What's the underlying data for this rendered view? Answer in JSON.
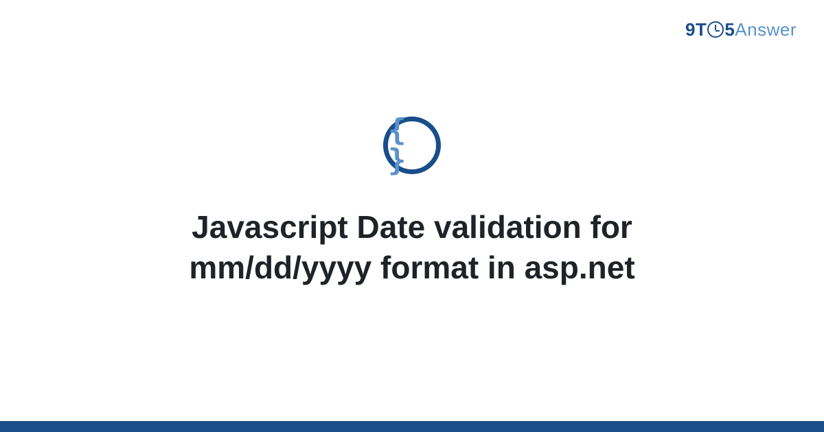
{
  "logo": {
    "part1": "9T",
    "part2": "5",
    "part3": "Answer"
  },
  "icon": {
    "glyph": "{ }"
  },
  "title": "Javascript Date validation for mm/dd/yyyy format in asp.net"
}
